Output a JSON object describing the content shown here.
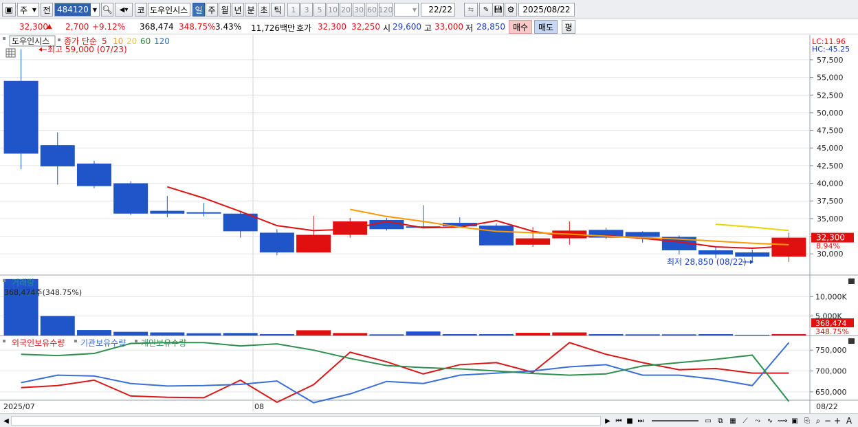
{
  "toolbar": {
    "period_mode": "주",
    "prev_label": "전",
    "code": "484120",
    "market_btn": "코",
    "stock_name": "도우인시스",
    "period_tabs": [
      "일",
      "주",
      "월",
      "년",
      "분",
      "초",
      "틱"
    ],
    "minute_tabs": [
      "1",
      "3",
      "5",
      "10",
      "20",
      "30",
      "60",
      "120"
    ],
    "count_value": "22",
    "count_total": "/22",
    "date": "2025/08/22"
  },
  "info": {
    "price": "32,300",
    "change": "2,700",
    "change_pct": "+9.12%",
    "volume": "368,474",
    "volume_pct": "348.75%",
    "turnover_pct": "3.43%",
    "amount": "11,726백만",
    "quote_label": "호가",
    "ask": "32,300",
    "bid": "32,250",
    "open_label": "시",
    "open": "29,600",
    "high_label": "고",
    "high": "33,000",
    "low_label": "저",
    "low": "28,850",
    "buy_label": "매수",
    "sell_label": "매도",
    "eval_label": "평"
  },
  "legend": {
    "stock": "도우인시스",
    "ma_label": "종가 단순",
    "ma_periods": [
      "5",
      "10",
      "20",
      "60",
      "120"
    ],
    "ma_colors": [
      "#e01010",
      "#ff9800",
      "#e6d600",
      "#2a8a3a",
      "#3070c0"
    ],
    "high_note": "최고 59,000 (07/23)",
    "low_note": "최저 28,850 (08/22)",
    "lc": "LC:11.96",
    "hc": "HC:-45.25",
    "last_price_tag": "32,300",
    "last_pct_tag": "8.94%"
  },
  "volume_pane": {
    "title": "거래량",
    "note": "368,474주(348.75%)",
    "last_tag": "368,474",
    "last_pct": "348.75%",
    "axis": [
      "10,000K",
      "5,000K"
    ]
  },
  "holdings_pane": {
    "series_names": [
      "외국인보유수량",
      "기관보유수량",
      "개인보유수량"
    ],
    "series_colors": [
      "#d81818",
      "#3a6fd8",
      "#2f8f4f"
    ],
    "axis": [
      "750,000",
      "700,000",
      "650,000"
    ]
  },
  "x_labels": {
    "start": "2025/07",
    "mid": "08",
    "end": "08/22"
  },
  "colors": {
    "up": "#e01010",
    "down": "#1f55c8",
    "grid": "#e3e6ea"
  },
  "chart_data": [
    {
      "type": "candlestick",
      "title": "도우인시스",
      "ylim": [
        27000,
        61000
      ],
      "yticks": [
        30000,
        32500,
        35000,
        37500,
        40000,
        42500,
        45000,
        47500,
        50000,
        52500,
        55000,
        57500
      ],
      "candles": [
        {
          "open": 54500,
          "high": 59000,
          "low": 42000,
          "close": 44200
        },
        {
          "open": 45400,
          "high": 47200,
          "low": 39800,
          "close": 42400
        },
        {
          "open": 42800,
          "high": 43200,
          "low": 39300,
          "close": 39600
        },
        {
          "open": 40000,
          "high": 40300,
          "low": 35500,
          "close": 35700
        },
        {
          "open": 36100,
          "high": 38200,
          "low": 35200,
          "close": 35700
        },
        {
          "open": 35900,
          "high": 37200,
          "low": 35300,
          "close": 35700
        },
        {
          "open": 35700,
          "high": 36000,
          "low": 32300,
          "close": 33200
        },
        {
          "open": 33000,
          "high": 33500,
          "low": 29800,
          "close": 30200
        },
        {
          "open": 30200,
          "high": 35400,
          "low": 30200,
          "close": 32700
        },
        {
          "open": 32700,
          "high": 35100,
          "low": 32300,
          "close": 34600
        },
        {
          "open": 34800,
          "high": 35100,
          "low": 33300,
          "close": 33500
        },
        {
          "open": 33900,
          "high": 36900,
          "low": 33600,
          "close": 33700
        },
        {
          "open": 34400,
          "high": 35200,
          "low": 33800,
          "close": 33900
        },
        {
          "open": 34000,
          "high": 34300,
          "low": 31200,
          "close": 31200
        },
        {
          "open": 31300,
          "high": 33800,
          "low": 31000,
          "close": 32200
        },
        {
          "open": 32200,
          "high": 34600,
          "low": 31300,
          "close": 33300
        },
        {
          "open": 33400,
          "high": 33700,
          "low": 32100,
          "close": 32300
        },
        {
          "open": 33100,
          "high": 33200,
          "low": 31600,
          "close": 32400
        },
        {
          "open": 32400,
          "high": 32600,
          "low": 29900,
          "close": 30500
        },
        {
          "open": 30500,
          "high": 31000,
          "low": 29400,
          "close": 29900
        },
        {
          "open": 30200,
          "high": 30600,
          "low": 28900,
          "close": 29600
        },
        {
          "open": 29600,
          "high": 33000,
          "low": 28850,
          "close": 32300
        }
      ],
      "ma5": [
        null,
        null,
        null,
        null,
        39500,
        37900,
        36000,
        34000,
        33300,
        33500,
        34600,
        33700,
        33800,
        34700,
        33200,
        32400,
        32600,
        32200,
        31700,
        31000,
        30800,
        31100
      ],
      "ma10": [
        null,
        null,
        null,
        null,
        null,
        null,
        null,
        null,
        null,
        36300,
        35300,
        34600,
        33800,
        33200,
        33000,
        32800,
        32500,
        32300,
        32100,
        31800,
        31500,
        31300
      ],
      "ma20": [
        null,
        null,
        null,
        null,
        null,
        null,
        null,
        null,
        null,
        null,
        null,
        null,
        null,
        null,
        null,
        null,
        null,
        null,
        null,
        34200,
        33800,
        33300
      ]
    },
    {
      "type": "bar",
      "title": "거래량",
      "ylim": [
        0,
        15000
      ],
      "values": [
        14500,
        5000,
        1400,
        950,
        800,
        600,
        650,
        350,
        1350,
        650,
        300,
        1050,
        350,
        350,
        700,
        800,
        350,
        300,
        300,
        350,
        200,
        370
      ],
      "directions": [
        "down",
        "down",
        "down",
        "down",
        "down",
        "down",
        "down",
        "down",
        "up",
        "up",
        "down",
        "down",
        "down",
        "down",
        "up",
        "up",
        "down",
        "down",
        "down",
        "down",
        "down",
        "up"
      ]
    },
    {
      "type": "line",
      "ylim": [
        630000,
        780000
      ],
      "series": [
        {
          "name": "외국인보유수량",
          "values": [
            660000,
            665000,
            678000,
            640000,
            637000,
            636000,
            678000,
            625000,
            667000,
            745000,
            722000,
            693000,
            715000,
            720000,
            697000,
            768000,
            740000,
            720000,
            703000,
            706000,
            695000,
            695000
          ]
        },
        {
          "name": "기관보유수량",
          "values": [
            672000,
            690000,
            688000,
            670000,
            664000,
            665000,
            668000,
            676000,
            624000,
            645000,
            675000,
            670000,
            690000,
            695000,
            700000,
            710000,
            715000,
            690000,
            690000,
            680000,
            665000,
            768000
          ]
        },
        {
          "name": "개인보유수량",
          "values": [
            740000,
            737000,
            742000,
            766000,
            768000,
            768000,
            760000,
            765000,
            750000,
            730000,
            713000,
            708000,
            705000,
            700000,
            694000,
            690000,
            693000,
            712000,
            720000,
            728000,
            738000,
            627000
          ]
        }
      ]
    }
  ]
}
